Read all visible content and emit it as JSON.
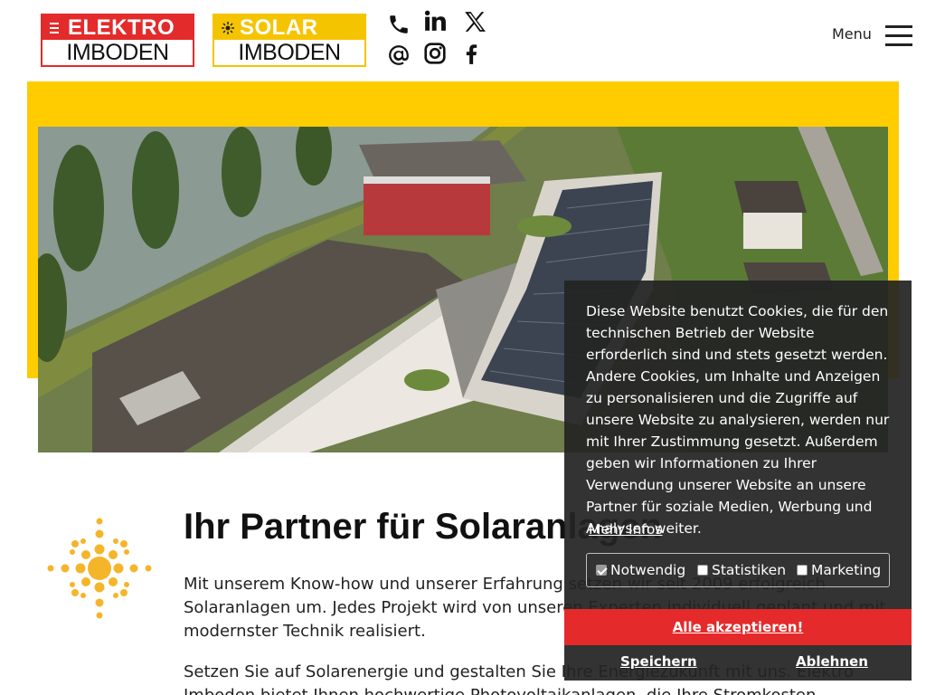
{
  "header": {
    "logo_elektro": {
      "top": "ELEKTRO",
      "bottom": "IMBODEN"
    },
    "logo_solar": {
      "top": "SOLAR",
      "bottom": "IMBODEN"
    },
    "menu_label": "Menu"
  },
  "social_icons": [
    "phone-icon",
    "linkedin-icon",
    "x-icon",
    "email-at-icon",
    "instagram-icon",
    "facebook-icon"
  ],
  "main": {
    "title": "Ihr Partner für Solaranlagen",
    "paragraph1": "Mit unserem Know-how und unserer Erfahrung setzen wir seit 2009 erfolgreich Solaranlagen um. Jedes Projekt wird von unseren Experten individuell geplant und mit modernster Technik realisiert.",
    "paragraph2": "Setzen Sie auf Solarenergie und gestalten Sie Ihre Energiezukunft mit uns. Elektro Imboden bietet Ihnen hochwertige Photovoltaikanlagen, die Ihre Stromkosten"
  },
  "cookie": {
    "text": "Diese Website benutzt Cookies, die für den technischen Betrieb der Website erforderlich sind und stets gesetzt werden. Andere Cookies, um Inhalte und Anzeigen zu personalisieren und die Zugriffe auf unsere Website zu analysieren, werden nur mit Ihrer Zustimmung gesetzt. Außerdem geben wir Informationen zu Ihrer Verwendung unserer Website an unsere Partner für soziale Medien, Werbung und Analysen weiter.",
    "more_info": "Mehr Infos",
    "options": [
      {
        "label": "Notwendig",
        "checked": true
      },
      {
        "label": "Statistiken",
        "checked": false
      },
      {
        "label": "Marketing",
        "checked": false
      }
    ],
    "accept_label": "Alle akzeptieren!",
    "save_label": "Speichern",
    "reject_label": "Ablehnen"
  },
  "colors": {
    "brand_red": "#e32b2b",
    "brand_yellow": "#ffcc00",
    "accept_red": "#e42a2a",
    "sun_orange": "#f5b52a"
  }
}
